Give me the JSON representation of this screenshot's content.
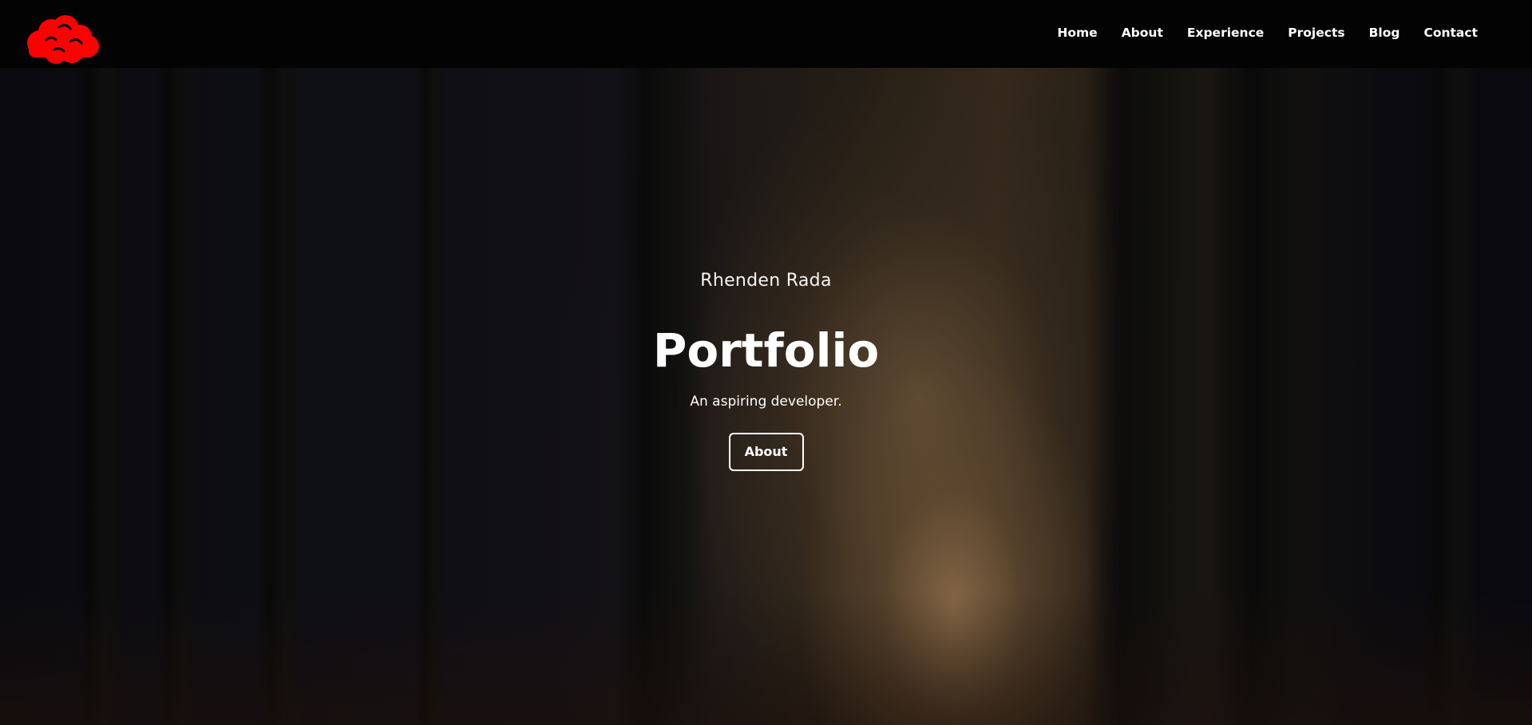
{
  "nav": {
    "logo_icon": "red-cloud-icon",
    "items": [
      {
        "label": "Home"
      },
      {
        "label": "About"
      },
      {
        "label": "Experience"
      },
      {
        "label": "Projects"
      },
      {
        "label": "Blog"
      },
      {
        "label": "Contact"
      }
    ]
  },
  "hero": {
    "name": "Rhenden Rada",
    "title": "Portfolio",
    "subtitle": "An aspiring developer.",
    "button_label": "About",
    "background": "dark-forest-path-image"
  },
  "colors": {
    "navbar_bg": "#030303",
    "logo": "#ff0000",
    "text": "#ffffff"
  }
}
